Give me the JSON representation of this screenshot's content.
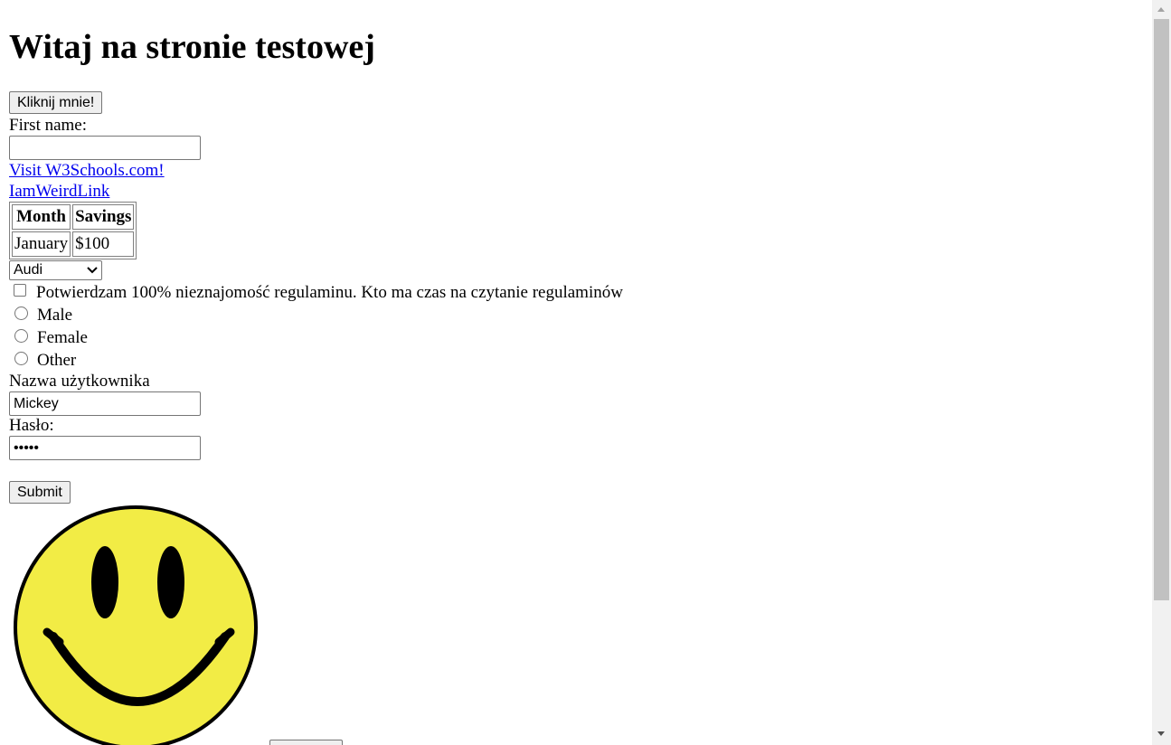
{
  "heading": "Witaj na stronie testowej",
  "click_button": "Kliknij mnie!",
  "first_name": {
    "label": "First name:",
    "value": ""
  },
  "links": {
    "w3schools": "Visit W3Schools.com!",
    "weird": "IamWeirdLink"
  },
  "table": {
    "headers": [
      "Month",
      "Savings"
    ],
    "rows": [
      [
        "January",
        "$100"
      ]
    ]
  },
  "car_select": {
    "selected": "Audi"
  },
  "terms_checkbox": {
    "checked": false,
    "label": "Potwierdzam 100% nieznajomość regulaminu. Kto ma czas na czytanie regulaminów"
  },
  "gender_radios": [
    {
      "label": "Male",
      "checked": false
    },
    {
      "label": "Female",
      "checked": false
    },
    {
      "label": "Other",
      "checked": false
    }
  ],
  "username": {
    "label": "Nazwa użytkownika",
    "value": "Mickey"
  },
  "password": {
    "label": "Hasło:",
    "value": "•••••"
  },
  "submit_button": "Submit",
  "image": {
    "name": "smiley-face"
  },
  "colors": {
    "link": "#0000ee",
    "smiley_fill": "#f2ec45",
    "smiley_stroke": "#000000"
  }
}
